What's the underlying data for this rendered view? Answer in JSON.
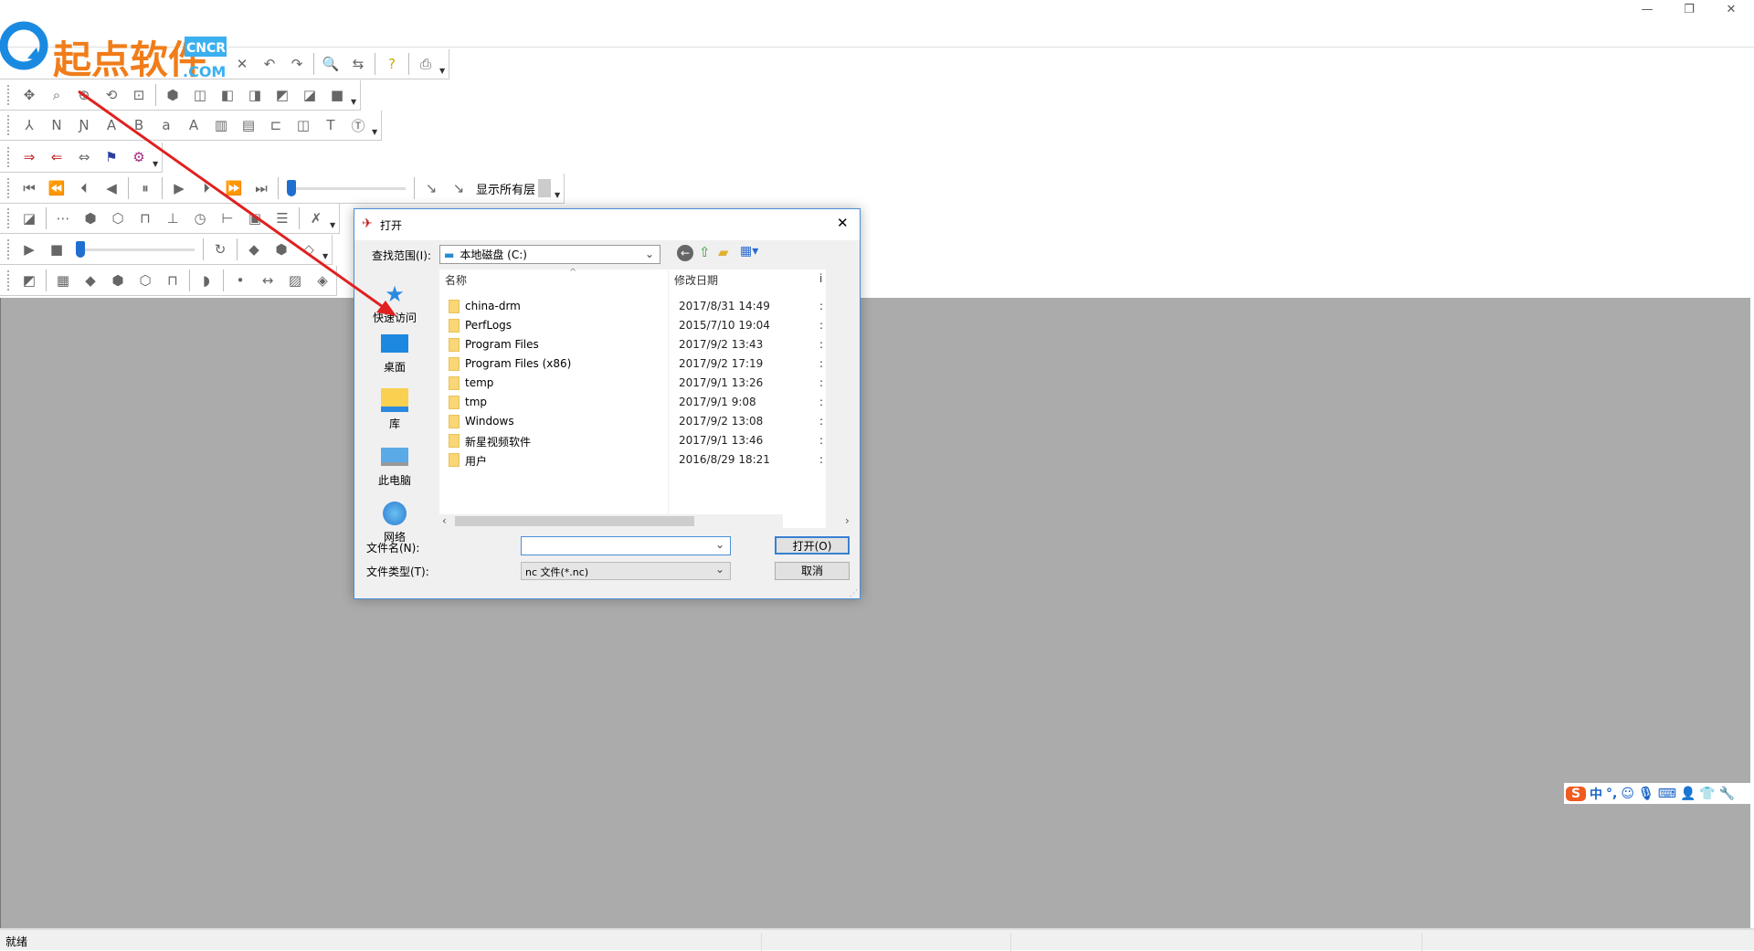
{
  "window": {
    "minimize": "—",
    "restore": "❐",
    "close": "✕"
  },
  "logo": {
    "text": "起点软件",
    "badge_top": "CNCRK",
    "badge_bottom": ".COM"
  },
  "toolbars": [
    {
      "items": [
        {
          "n": "close-icon",
          "g": "✕"
        },
        {
          "n": "undo-icon",
          "g": "↶"
        },
        {
          "n": "redo-icon",
          "g": "↷"
        },
        "|",
        {
          "n": "find-icon",
          "g": "🔍"
        },
        {
          "n": "find-replace-icon",
          "g": "⇆"
        },
        "|",
        {
          "n": "help-icon",
          "g": "?",
          "c": "#c8a800"
        },
        "|",
        {
          "n": "print-icon",
          "g": "⎙"
        },
        "v"
      ],
      "pad": 250
    },
    {
      "items": [
        {
          "n": "pan-icon",
          "g": "✥"
        },
        {
          "n": "zoom-window-icon",
          "g": "⌕"
        },
        {
          "n": "zoom-in-icon",
          "g": "⊕"
        },
        {
          "n": "zoom-dynamic-icon",
          "g": "⟲"
        },
        {
          "n": "zoom-fit-icon",
          "g": "⊡"
        },
        "|",
        {
          "n": "iso-view-icon",
          "g": "⬢"
        },
        {
          "n": "top-view-icon",
          "g": "◫"
        },
        {
          "n": "front-view-icon",
          "g": "◧"
        },
        {
          "n": "right-view-icon",
          "g": "◨"
        },
        {
          "n": "left-view-icon",
          "g": "◩"
        },
        {
          "n": "back-view-icon",
          "g": "◪"
        },
        {
          "n": "bottom-view-icon",
          "g": "■"
        },
        "v"
      ]
    },
    {
      "items": [
        {
          "n": "compass-icon",
          "g": "⅄"
        },
        {
          "n": "n-number-icon",
          "g": "N"
        },
        {
          "n": "n-remove-icon",
          "g": "Ɲ"
        },
        {
          "n": "a-to-b-icon",
          "g": "A"
        },
        {
          "n": "a-b-swap-icon",
          "g": "B"
        },
        {
          "n": "lower-to-upper-icon",
          "g": "a"
        },
        {
          "n": "upper-to-lower-icon",
          "g": "A"
        },
        {
          "n": "column-icon",
          "g": "▥"
        },
        {
          "n": "column2-icon",
          "g": "▤"
        },
        {
          "n": "tool-icon",
          "g": "⊏"
        },
        {
          "n": "mirror-icon",
          "g": "◫"
        },
        {
          "n": "text-icon",
          "g": "T"
        },
        {
          "n": "text-rotate-icon",
          "g": "Ⓣ"
        },
        "v"
      ]
    },
    {
      "items": [
        {
          "n": "send-icon",
          "g": "⇒",
          "c": "#c02020"
        },
        {
          "n": "receive-icon",
          "g": "⇐",
          "c": "#c02020"
        },
        {
          "n": "transfer-icon",
          "g": "⇔"
        },
        {
          "n": "flag-icon",
          "g": "⚑",
          "c": "#2a3fa0"
        },
        {
          "n": "settings-icon",
          "g": "⚙",
          "c": "#a03080"
        },
        "v"
      ]
    },
    {
      "items": [
        {
          "n": "first-icon",
          "g": "⏮"
        },
        {
          "n": "step-back-block-icon",
          "g": "⏪"
        },
        {
          "n": "prev-icon",
          "g": "⏴"
        },
        {
          "n": "step-back-icon",
          "g": "◀"
        },
        "|",
        {
          "n": "pause-icon",
          "g": "⏸"
        },
        "|",
        {
          "n": "play-icon",
          "g": "▶"
        },
        {
          "n": "next-icon",
          "g": "⏵"
        },
        {
          "n": "step-forward-icon",
          "g": "⏩"
        },
        {
          "n": "last-icon",
          "g": "⏭"
        },
        "|",
        "S",
        "|",
        {
          "n": "tool-path-icon",
          "g": "↘"
        },
        {
          "n": "xyz-icon",
          "g": "↘"
        },
        "L",
        "v"
      ]
    },
    {
      "items": [
        {
          "n": "simulate-icon",
          "g": "◪"
        },
        "|",
        {
          "n": "points-icon",
          "g": "⋯"
        },
        {
          "n": "solid-add-icon",
          "g": "⬢"
        },
        {
          "n": "solid-sub-icon",
          "g": "⬡"
        },
        {
          "n": "tool-holder-icon",
          "g": "⊓"
        },
        {
          "n": "fixture-icon",
          "g": "⊥"
        },
        {
          "n": "clock-icon",
          "g": "◷"
        },
        {
          "n": "measure-icon",
          "g": "⊢"
        },
        {
          "n": "image-icon",
          "g": "▣"
        },
        {
          "n": "report-icon",
          "g": "☰"
        },
        "|",
        {
          "n": "clear-icon",
          "g": "✗"
        },
        "v"
      ]
    },
    {
      "items": [
        {
          "n": "play-sim-icon",
          "g": "▶"
        },
        {
          "n": "stop-icon",
          "g": "■"
        },
        "S",
        "|",
        {
          "n": "refresh-icon",
          "g": "↻"
        },
        "|",
        {
          "n": "stock-icon",
          "g": "◆"
        },
        {
          "n": "stock2-icon",
          "g": "⬢"
        },
        {
          "n": "stock3-icon",
          "g": "◇"
        },
        "v"
      ]
    },
    {
      "items": [
        {
          "n": "section-icon",
          "g": "◩"
        },
        "|",
        {
          "n": "grid-icon",
          "g": "▦"
        },
        {
          "n": "solid-icon",
          "g": "◆"
        },
        {
          "n": "solid-load-icon",
          "g": "⬢"
        },
        {
          "n": "solid-edit-icon",
          "g": "⬡"
        },
        {
          "n": "tool2-icon",
          "g": "⊓"
        },
        "|",
        {
          "n": "shade-icon",
          "g": "◗"
        },
        "|",
        {
          "n": "axis-icon",
          "g": "•"
        },
        {
          "n": "dimension-icon",
          "g": "↔"
        },
        {
          "n": "hatch-icon",
          "g": "▨"
        },
        {
          "n": "compare-icon",
          "g": "◈"
        }
      ]
    }
  ],
  "layer_select": "显示所有层",
  "status": {
    "ready": "就绪"
  },
  "dialog": {
    "title": "打开",
    "close": "✕",
    "look_in_label": "查找范围(I):",
    "look_in_value": "本地磁盘 (C:)",
    "places": [
      "快速访问",
      "桌面",
      "库",
      "此电脑",
      "网络"
    ],
    "columns": {
      "name": "名称",
      "date": "修改日期",
      "more": "i"
    },
    "files": [
      {
        "name": "china-drm",
        "date": "2017/8/31 14:49"
      },
      {
        "name": "PerfLogs",
        "date": "2015/7/10 19:04"
      },
      {
        "name": "Program Files",
        "date": "2017/9/2 13:43"
      },
      {
        "name": "Program Files (x86)",
        "date": "2017/9/2 17:19"
      },
      {
        "name": "temp",
        "date": "2017/9/1 13:26"
      },
      {
        "name": "tmp",
        "date": "2017/9/1 9:08"
      },
      {
        "name": "Windows",
        "date": "2017/9/2 13:08"
      },
      {
        "name": "新星视频软件",
        "date": "2017/9/1 13:46"
      },
      {
        "name": "用户",
        "date": "2016/8/29 18:21"
      }
    ],
    "filename_label": "文件名(N):",
    "filename_value": "",
    "filetype_label": "文件类型(T):",
    "filetype_value": "nc 文件(*.nc)",
    "open_button": "打开(O)",
    "cancel_button": "取消"
  },
  "ime": {
    "lang": "中",
    "punct": "°,"
  },
  "colors": {
    "accent": "#1e6fd0",
    "arrow": "#e02020",
    "workspace": "#ababab"
  }
}
